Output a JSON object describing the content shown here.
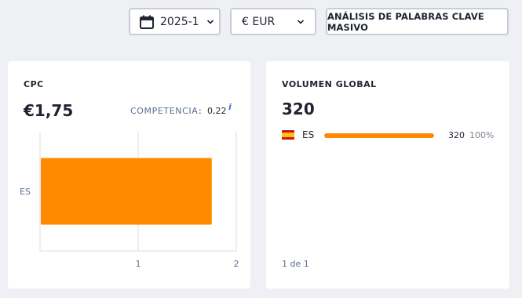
{
  "toolbar": {
    "date_label": "2025-1",
    "currency_label": "€ EUR",
    "bulk_button_label": "ANÁLISIS DE PALABRAS CLAVE MASIVO"
  },
  "cpc_card": {
    "title": "CPC",
    "value": "€1,75",
    "competition_label": "COMPETENCIA",
    "competition_colon": ":",
    "competition_value": "0,22",
    "info_icon": "i"
  },
  "volume_card": {
    "title": "VOLUMEN GLOBAL",
    "value": "320",
    "rows": [
      {
        "flag": "spain-flag-icon",
        "country": "ES",
        "value": "320",
        "percent": "100%",
        "share": 1.0
      }
    ],
    "pager": "1 de 1"
  },
  "colors": {
    "accent_orange": "#ff8a00",
    "muted_text": "#5b6f8f",
    "background": "#eef0f3"
  },
  "chart_data": {
    "type": "bar",
    "orientation": "horizontal",
    "categories": [
      "ES"
    ],
    "values": [
      1.75
    ],
    "xticks": [
      "1",
      "2"
    ],
    "xlim": [
      0,
      2
    ],
    "grid": true
  }
}
